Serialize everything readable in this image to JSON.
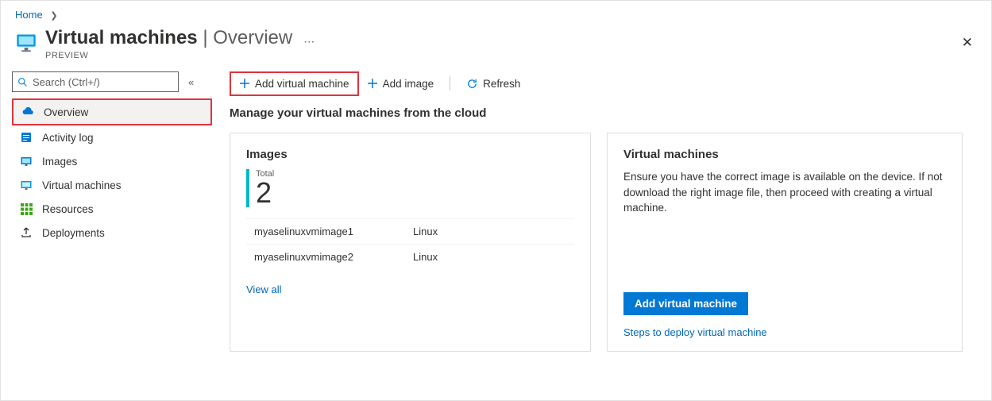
{
  "breadcrumb": {
    "home": "Home"
  },
  "header": {
    "title_main": "Virtual machines",
    "title_sub": "Overview",
    "preview": "PREVIEW"
  },
  "sidebar": {
    "search_placeholder": "Search (Ctrl+/)",
    "items": {
      "overview": "Overview",
      "activity": "Activity log",
      "images": "Images",
      "vms": "Virtual machines",
      "resources": "Resources",
      "deployments": "Deployments"
    }
  },
  "toolbar": {
    "add_vm": "Add virtual machine",
    "add_image": "Add image",
    "refresh": "Refresh"
  },
  "main": {
    "subhead": "Manage your virtual machines from the cloud"
  },
  "images_card": {
    "title": "Images",
    "total_label": "Total",
    "total_value": "2",
    "rows": [
      {
        "name": "myaselinuxvmimage1",
        "os": "Linux"
      },
      {
        "name": "myaselinuxvmimage2",
        "os": "Linux"
      }
    ],
    "viewall": "View all"
  },
  "vm_card": {
    "title": "Virtual machines",
    "desc": "Ensure you have the correct image is available on the device. If not download the right image file, then proceed with creating a virtual machine.",
    "button": "Add virtual machine",
    "steps": "Steps to deploy virtual machine"
  }
}
